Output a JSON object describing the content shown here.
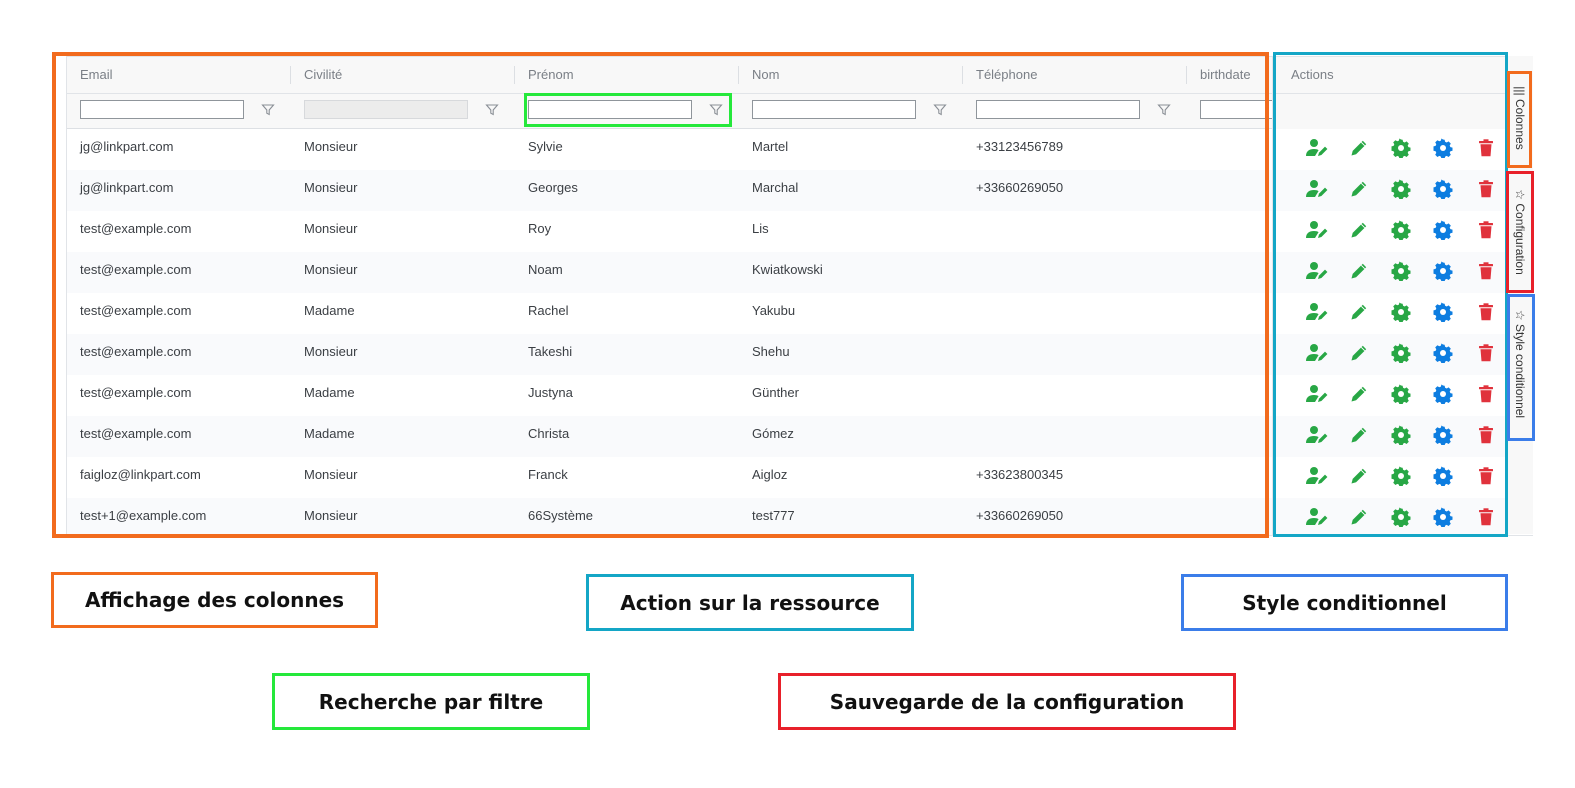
{
  "grid": {
    "columns": [
      "Email",
      "Civilité",
      "Prénom",
      "Nom",
      "Téléphone",
      "birthdate"
    ],
    "actions_header": "Actions",
    "rows": [
      [
        "jg@linkpart.com",
        "Monsieur",
        "Sylvie",
        "Martel",
        "+33123456789"
      ],
      [
        "jg@linkpart.com",
        "Monsieur",
        "Georges",
        "Marchal",
        "+33660269050"
      ],
      [
        "test@example.com",
        "Monsieur",
        "Roy",
        "Lis",
        ""
      ],
      [
        "test@example.com",
        "Monsieur",
        "Noam",
        "Kwiatkowski",
        ""
      ],
      [
        "test@example.com",
        "Madame",
        "Rachel",
        "Yakubu",
        ""
      ],
      [
        "test@example.com",
        "Monsieur",
        "Takeshi",
        "Shehu",
        ""
      ],
      [
        "test@example.com",
        "Madame",
        "Justyna",
        "Günther",
        ""
      ],
      [
        "test@example.com",
        "Madame",
        "Christa",
        "Gómez",
        ""
      ],
      [
        "faigloz@linkpart.com",
        "Monsieur",
        "Franck",
        "Aigloz",
        "+33623800345"
      ],
      [
        "test+1@example.com",
        "Monsieur",
        "66Système",
        "test777",
        "+33660269050"
      ]
    ],
    "action_icons": [
      "user-edit-icon",
      "pencil-icon",
      "cog-icon",
      "cog-icon",
      "trash-icon"
    ],
    "action_colors": {
      "green": "#28a745",
      "blue": "#0d7de0",
      "red": "#e0323c"
    }
  },
  "side_panel": {
    "tabs": [
      "Colonnes",
      "Configuration",
      "Style conditionnel"
    ]
  },
  "annotations": {
    "columns_display": "Affichage des colonnes",
    "resource_action": "Action sur la ressource",
    "conditional_style": "Style conditionnel",
    "filter_search": "Recherche par filtre",
    "save_config": "Sauvegarde de la configuration",
    "colors": {
      "orange": "#f26b1d",
      "cyan": "#14a6c6",
      "blue": "#3b7de9",
      "green": "#25e83b",
      "red": "#e8202a"
    }
  }
}
